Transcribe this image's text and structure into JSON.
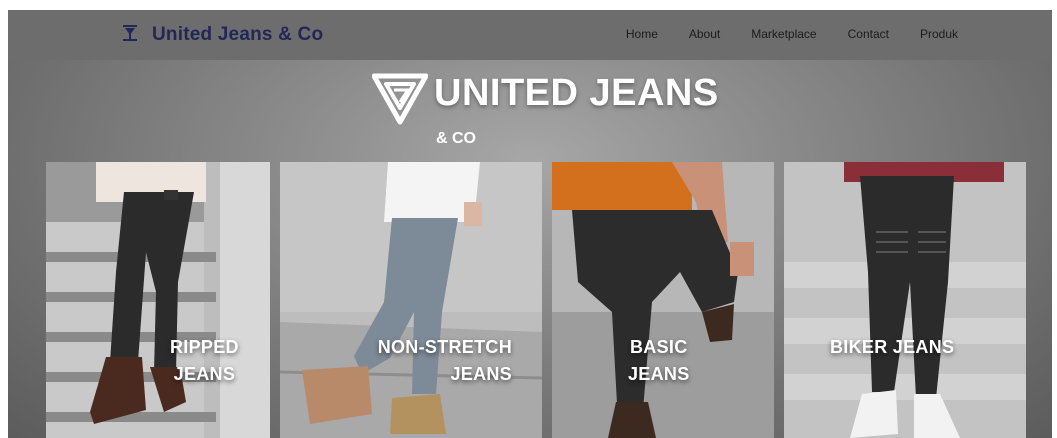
{
  "navbar": {
    "brand": "United Jeans & Co",
    "brand_icon": "hourglass-logo-icon",
    "links": [
      "Home",
      "About",
      "Marketplace",
      "Contact",
      "Produk"
    ]
  },
  "hero": {
    "logo_text": "UNITED JEANS",
    "logo_subtext": "& CO",
    "logo_icon": "triangle-logo-icon"
  },
  "categories": [
    {
      "line1": "RIPPED",
      "line2": "JEANS"
    },
    {
      "line1": "NON-STRETCH",
      "line2": "JEANS"
    },
    {
      "line1": "BASIC",
      "line2": "JEANS"
    },
    {
      "line1": "BIKER JEANS",
      "line2": ""
    }
  ],
  "colors": {
    "navbar_bg": "#6d6d6d",
    "brand_text": "#232659",
    "nav_link": "#1c1c1c",
    "hero_text": "#ffffff"
  }
}
